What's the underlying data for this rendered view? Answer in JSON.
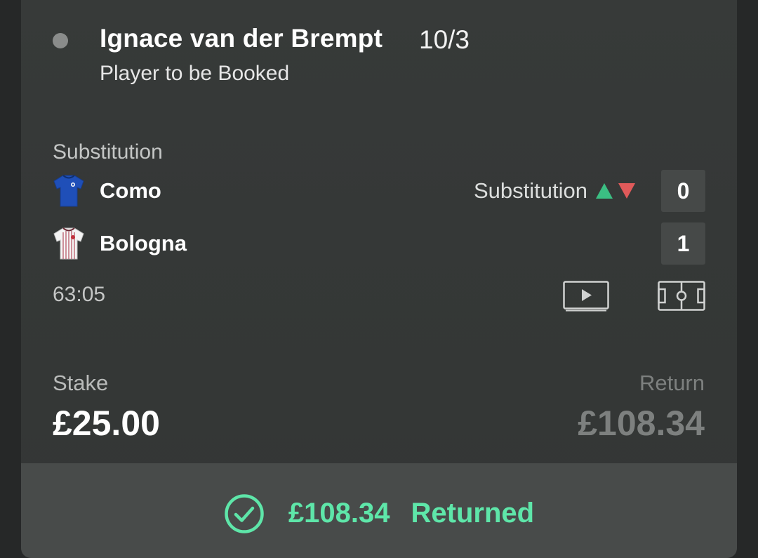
{
  "bet": {
    "selection": "Ignace van der Brempt",
    "odds": "10/3",
    "market": "Player to be Booked"
  },
  "event": {
    "status": "Substitution",
    "clock": "63:05",
    "live_event_label": "Substitution",
    "home": {
      "name": "Como",
      "score": "0",
      "kit_color": "#1f4fb8"
    },
    "away": {
      "name": "Bologna",
      "score": "1",
      "kit_color": "#f2f2f2"
    }
  },
  "icons": {
    "video": "play-video-icon",
    "pitch": "pitch-tracker-icon",
    "settled": "check-circle-icon",
    "status_dot": "status-dot-icon"
  },
  "stake": {
    "label": "Stake",
    "value": "£25.00"
  },
  "return": {
    "label": "Return",
    "value": "£108.34"
  },
  "settlement": {
    "amount": "£108.34",
    "label": "Returned",
    "color": "#5ee6a9"
  },
  "colors": {
    "up_arrow": "#3bbf83",
    "down_arrow": "#e05a5a",
    "card_bg": "#363938",
    "footer_bg": "#484b4a"
  }
}
